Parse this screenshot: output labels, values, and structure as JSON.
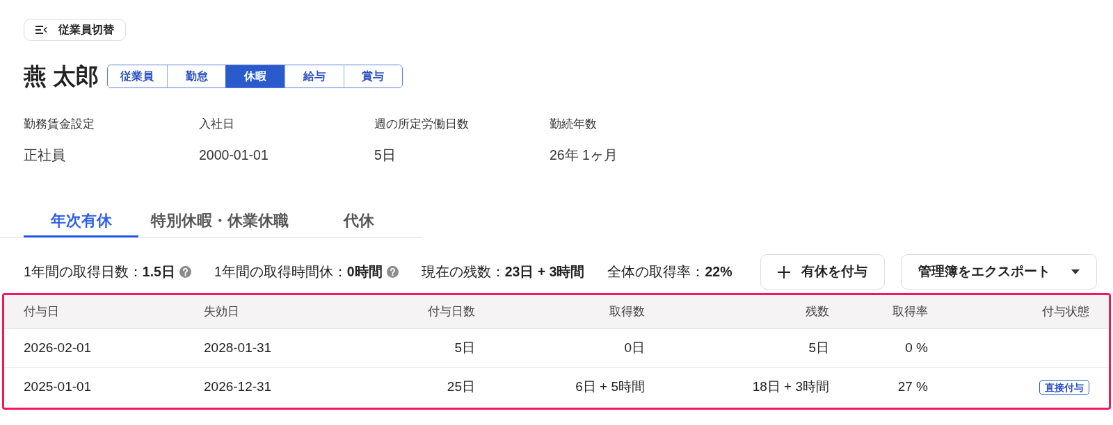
{
  "switch_button": {
    "label": "従業員切替"
  },
  "employee": {
    "name": "燕 太郎"
  },
  "section_tabs": [
    {
      "label": "従業員",
      "selected": false
    },
    {
      "label": "勤怠",
      "selected": false
    },
    {
      "label": "休暇",
      "selected": true
    },
    {
      "label": "給与",
      "selected": false
    },
    {
      "label": "賞与",
      "selected": false
    }
  ],
  "profile_fields": [
    {
      "label": "勤務賃金設定",
      "value": "正社員"
    },
    {
      "label": "入社日",
      "value": "2000-01-01"
    },
    {
      "label": "週の所定労働日数",
      "value": "5日"
    },
    {
      "label": "勤続年数",
      "value": "26年 1ヶ月"
    }
  ],
  "leave_tabs": [
    {
      "label": "年次有休",
      "selected": true
    },
    {
      "label": "特別休暇・休業休職",
      "selected": false
    },
    {
      "label": "代休",
      "selected": false
    }
  ],
  "summary": [
    {
      "text": "1年間の取得日数：**1.5日**",
      "help": true
    },
    {
      "text": "1年間の取得時間休：**0時間**",
      "help": true
    },
    {
      "text": "現在の残数：**23日 + 3時間**",
      "help": false
    },
    {
      "text": "全体の取得率：**22%**",
      "help": false
    }
  ],
  "actions": [
    {
      "kind": "add",
      "label": "有休を付与"
    },
    {
      "kind": "dropdown",
      "label": "管理簿をエクスポート"
    }
  ],
  "grant_table": {
    "highlighted": true,
    "columns": [
      "付与日",
      "失効日",
      "付与日数",
      "取得数",
      "残数",
      "取得率",
      "付与状態"
    ],
    "rows": [
      {
        "cells": [
          "2026-02-01",
          "2028-01-31",
          "5日",
          "0日",
          "5日",
          "0 %"
        ]
      },
      {
        "cells": [
          "2025-01-01",
          "2026-12-31",
          "25日",
          "6日 + 5時間",
          "18日 + 3時間",
          "27 %"
        ],
        "status": "直接付与"
      }
    ]
  }
}
